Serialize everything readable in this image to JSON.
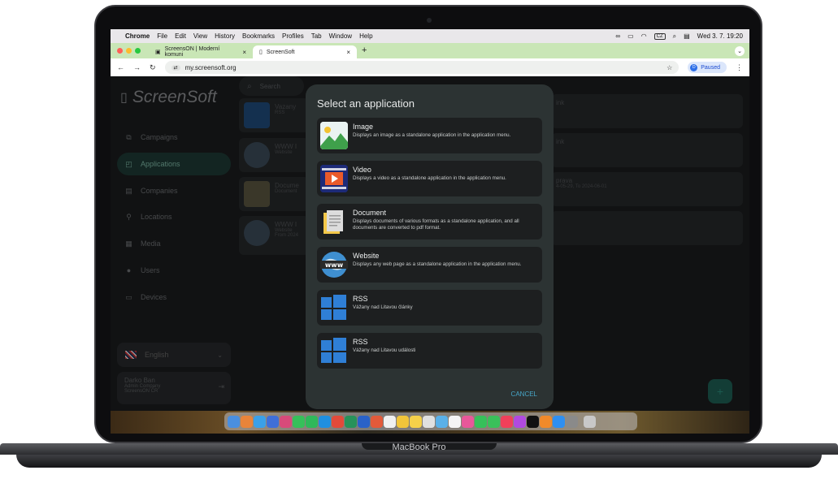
{
  "device": {
    "label": "MacBook Pro"
  },
  "menubar": {
    "app_name": "Chrome",
    "items": [
      "File",
      "Edit",
      "View",
      "History",
      "Bookmarks",
      "Profiles",
      "Tab",
      "Window",
      "Help"
    ],
    "keyboard": "CZ",
    "datetime": "Wed 3. 7.  19:20"
  },
  "browser": {
    "tabs": [
      {
        "title": "ScreensON | Moderní komuni"
      },
      {
        "title": "ScreenSoft"
      }
    ],
    "url": "my.screensoft.org",
    "profile_status": "Paused"
  },
  "sidebar": {
    "logo": "ScreenSoft",
    "items": [
      {
        "label": "Campaigns",
        "icon": "campaigns-icon"
      },
      {
        "label": "Applications",
        "icon": "applications-icon"
      },
      {
        "label": "Companies",
        "icon": "companies-icon"
      },
      {
        "label": "Locations",
        "icon": "locations-icon"
      },
      {
        "label": "Media",
        "icon": "media-icon"
      },
      {
        "label": "Users",
        "icon": "users-icon"
      },
      {
        "label": "Devices",
        "icon": "devices-icon"
      }
    ],
    "language": "English",
    "user": {
      "name": "Darko Ban",
      "role": "Admin Company",
      "company": "ScreensON ČR"
    }
  },
  "content": {
    "search_placeholder": "Search",
    "cards_left": [
      {
        "title": "Vazany",
        "sub": "RSS",
        "sub2": ""
      },
      {
        "title": "WWW I",
        "sub": "Website",
        "sub2": ""
      },
      {
        "title": "Docume",
        "sub": "Document",
        "sub2": ""
      },
      {
        "title": "WWW I",
        "sub": "Website",
        "sub2": "From 2024"
      }
    ],
    "cards_right": [
      {
        "title": "ink",
        "sub": ""
      },
      {
        "title": "ink",
        "sub": ""
      },
      {
        "title": "prava",
        "sub": "4-05-29, To 2024-06-01"
      },
      {
        "title": "",
        "sub": ""
      }
    ]
  },
  "dialog": {
    "title": "Select an application",
    "options": [
      {
        "name": "Image",
        "description": "Displays an image as a standalone application in the application menu.",
        "icon": "image-icon"
      },
      {
        "name": "Video",
        "description": "Displays a video as a standalone application in the application menu.",
        "icon": "video-icon"
      },
      {
        "name": "Document",
        "description": "Displays documents of various formats as a standalone application, and all documents are converted to pdf format.",
        "icon": "document-icon"
      },
      {
        "name": "Website",
        "description": "Displays any web page as a standalone application in the application menu.",
        "icon": "website-icon"
      },
      {
        "name": "RSS",
        "description": "Vážany nad Litavou články",
        "icon": "rss-icon"
      },
      {
        "name": "RSS",
        "description": "Vážany nad Litavou události",
        "icon": "rss-icon"
      }
    ],
    "cancel_label": "CANCEL"
  },
  "colors": {
    "accent": "#47a7c9",
    "nav_active": "#1e3a35",
    "dialog_bg": "#2c3333",
    "tab_bar": "#c9e6b6"
  }
}
